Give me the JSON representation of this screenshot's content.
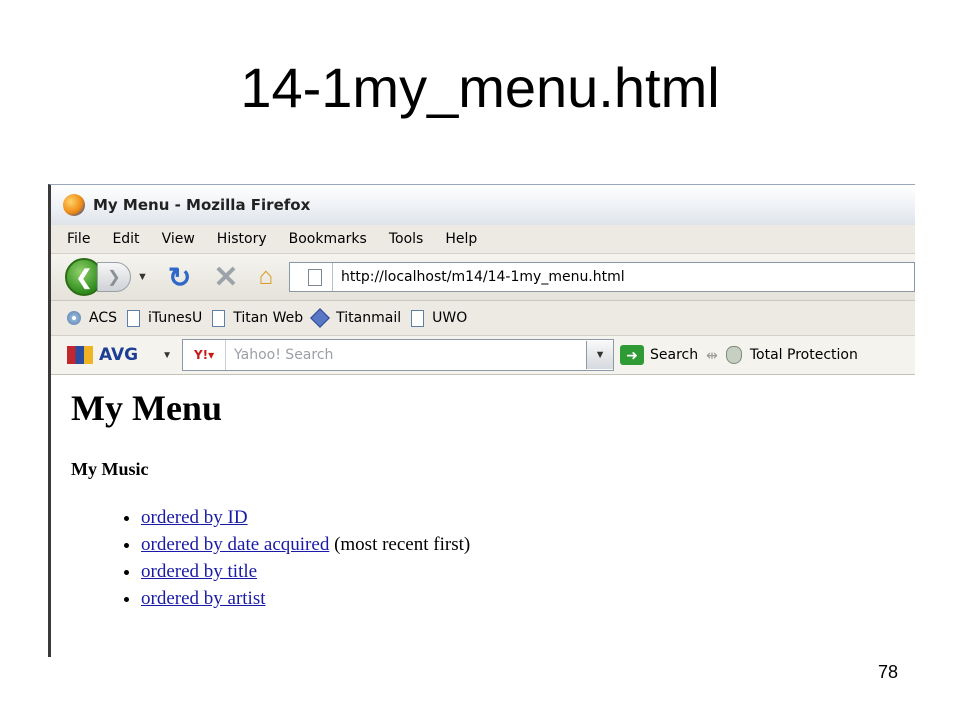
{
  "slide": {
    "title": "14-1my_menu.html",
    "page_number": "78"
  },
  "window": {
    "title": "My Menu - Mozilla Firefox"
  },
  "menubar": {
    "items": [
      "File",
      "Edit",
      "View",
      "History",
      "Bookmarks",
      "Tools",
      "Help"
    ]
  },
  "navbar": {
    "back_glyph": "❮",
    "forward_glyph": "❯",
    "url": "http://localhost/m14/14-1my_menu.html"
  },
  "bookmarks": {
    "items": [
      "ACS",
      "iTunesU",
      "Titan Web",
      "Titanmail",
      "UWO"
    ]
  },
  "avg_toolbar": {
    "brand": "AVG",
    "yahoo_logo": "Y!▾",
    "search_placeholder": "Yahoo! Search",
    "search_label": "Search",
    "protection_label": "Total Protection"
  },
  "page": {
    "heading": "My Menu",
    "section": "My Music",
    "links": [
      {
        "text": "ordered by ID",
        "suffix": ""
      },
      {
        "text": "ordered by date acquired",
        "suffix": " (most recent first)"
      },
      {
        "text": "ordered by title",
        "suffix": ""
      },
      {
        "text": "ordered by artist",
        "suffix": ""
      }
    ]
  },
  "colors": {
    "link": "#1a1aa8",
    "chrome": "#eceae3"
  }
}
